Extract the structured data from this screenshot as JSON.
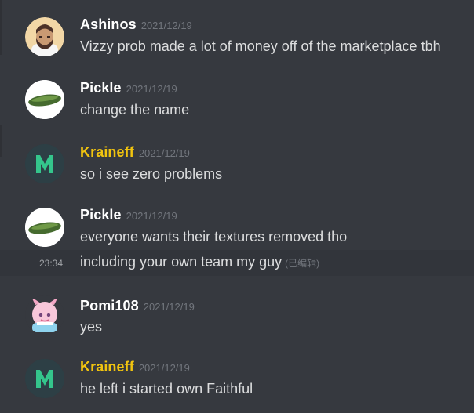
{
  "messages": [
    {
      "author": "Ashinos",
      "timestamp": "2021/12/19",
      "lines": [
        "Vizzy prob made a lot of money off of the marketplace tbh"
      ],
      "avatar": "bearded-man-avatar"
    },
    {
      "author": "Pickle",
      "timestamp": "2021/12/19",
      "lines": [
        "change the name"
      ],
      "avatar": "pickle-avatar"
    },
    {
      "author": "Kraineff",
      "timestamp": "2021/12/19",
      "lines": [
        "so i see zero problems"
      ],
      "avatar": "m-logo-avatar"
    },
    {
      "author": "Pickle",
      "timestamp": "2021/12/19",
      "lines": [
        "everyone wants their textures removed tho"
      ],
      "avatar": "pickle-avatar"
    },
    {
      "hover_time": "23:34",
      "text": "including your own team my guy",
      "edited": "(已编辑)"
    },
    {
      "author": "Pomi108",
      "timestamp": "2021/12/19",
      "lines": [
        "yes"
      ],
      "avatar": "pink-anime-avatar"
    },
    {
      "author": "Kraineff",
      "timestamp": "2021/12/19",
      "lines": [
        "he left i started own Faithful"
      ],
      "avatar": "m-logo-avatar"
    }
  ],
  "colors": {
    "background": "#36393f",
    "author_default": "#ffffff",
    "author_gold": "#f1c40f",
    "text": "#dcddde",
    "muted": "#72767d"
  }
}
